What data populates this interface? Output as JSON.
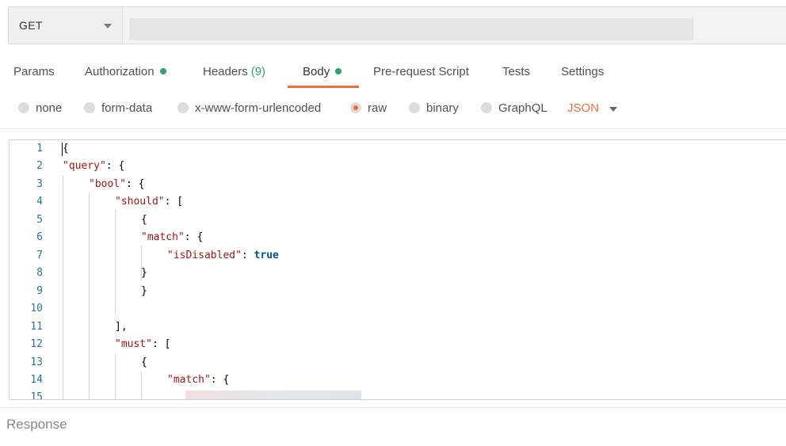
{
  "request": {
    "method": "GET",
    "url": ""
  },
  "tabs": [
    {
      "label": "Params"
    },
    {
      "label": "Authorization"
    },
    {
      "label": "Headers",
      "count": "(9)"
    },
    {
      "label": "Body"
    },
    {
      "label": "Pre-request Script"
    },
    {
      "label": "Tests"
    },
    {
      "label": "Settings"
    }
  ],
  "body_types": [
    "none",
    "form-data",
    "x-www-form-urlencoded",
    "raw",
    "binary",
    "GraphQL"
  ],
  "selected_body_type": "raw",
  "format": "JSON",
  "editor": {
    "line_numbers": [
      "1",
      "2",
      "3",
      "4",
      "5",
      "6",
      "7",
      "8",
      "9",
      "10",
      "11",
      "12",
      "13",
      "14",
      "15"
    ],
    "tokens": {
      "open_brace": "{",
      "query_key": "\"query\"",
      "bool_key": "\"bool\"",
      "should_key": "\"should\"",
      "match_key": "\"match\"",
      "isDisabled_key": "\"isDisabled\"",
      "true_value": "true",
      "must_key": "\"must\"",
      "close_brace": "}",
      "close_bracket_comma": "],",
      "colon_brace": ": {",
      "colon_bracket": ": [",
      "colon": ": "
    }
  },
  "response_label": "Response",
  "colors": {
    "accent": "#f26b3a",
    "status_dot": "#2fa36b",
    "json_key": "#a31515",
    "json_bool": "#0451a5",
    "line_number": "#237893"
  },
  "icons": [
    "chevron-down-icon",
    "radio-icon",
    "status-dot-icon"
  ]
}
